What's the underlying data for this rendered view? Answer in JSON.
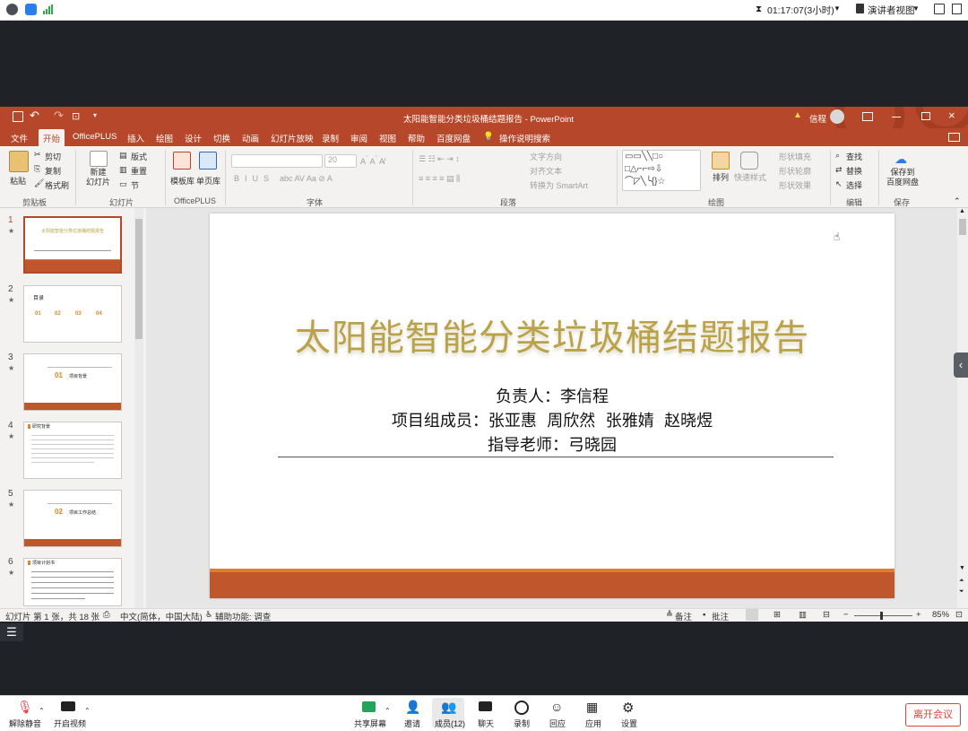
{
  "meeting": {
    "timer": "01:17:07(3小时)",
    "view_mode": "演讲者视图",
    "bottom_buttons": {
      "mute": "解除静音",
      "video": "开启视频",
      "share": "共享屏幕",
      "invite": "邀请",
      "members": "成员(12)",
      "chat": "聊天",
      "record": "录制",
      "react": "回应",
      "apps": "应用",
      "settings": "设置"
    },
    "leave": "离开会议"
  },
  "ppt": {
    "window_title": "太阳能智能分类垃圾桶结题报告 - PowerPoint",
    "user": "信程",
    "tabs": [
      "文件",
      "开始",
      "OfficePLUS",
      "插入",
      "绘图",
      "设计",
      "切换",
      "动画",
      "幻灯片放映",
      "录制",
      "审阅",
      "视图",
      "帮助",
      "百度网盘"
    ],
    "active_tab": "开始",
    "search": "操作说明搜索",
    "ribbon": {
      "paste": "粘贴",
      "cut": "剪切",
      "copy": "复制",
      "format_painter": "格式刷",
      "new_slide": "新建\n幻灯片",
      "layout": "版式",
      "reset": "重置",
      "section": "节",
      "template_lib": "模板库",
      "single_page_lib": "单页库",
      "font_size": "20",
      "text_direction": "文字方向",
      "align_text": "对齐文本",
      "smartart": "转换为 SmartArt",
      "arrange": "排列",
      "quick_styles": "快速样式",
      "shape_fill": "形状填充",
      "shape_outline": "形状轮廓",
      "shape_effects": "形状效果",
      "find": "查找",
      "replace": "替换",
      "select": "选择",
      "save_baidu": "保存到\n百度网盘",
      "groups": {
        "clipboard": "剪贴板",
        "slides": "幻灯片",
        "officeplus": "OfficePLUS",
        "font": "字体",
        "paragraph": "段落",
        "drawing": "绘图",
        "editing": "编辑",
        "save": "保存"
      }
    },
    "slide": {
      "title": "太阳能智能分类垃圾桶结题报告",
      "line1": "负责人：李信程",
      "line2": "项目组成员：张亚惠  周欣然  张雅婧  赵晓煜",
      "line3": "指导老师：弓晓园"
    },
    "thumbs": [
      {
        "num": "1",
        "star": "★",
        "label": "太阳能智能分类垃圾桶结题报告"
      },
      {
        "num": "2",
        "star": "★",
        "label": "目录",
        "items": [
          "01",
          "02",
          "03",
          "04"
        ]
      },
      {
        "num": "3",
        "star": "★",
        "label": "项目背景",
        "index": "01"
      },
      {
        "num": "4",
        "star": "★",
        "label": "研究背景"
      },
      {
        "num": "5",
        "star": "★",
        "label": "项目工作总结",
        "index": "02"
      },
      {
        "num": "6",
        "star": "★",
        "label": "项目计划书"
      }
    ],
    "status": {
      "slide_info": "幻灯片 第 1 张，共 18 张",
      "language": "中文(简体，中国大陆)",
      "accessibility": "辅助功能: 调查",
      "notes": "备注",
      "comments": "批注",
      "zoom": "85%"
    },
    "colors": {
      "accent": "#b7472a",
      "slide_band": "#c0562b",
      "slide_band_top": "#e07d2d",
      "thumb_accent": "#e8821e"
    }
  }
}
